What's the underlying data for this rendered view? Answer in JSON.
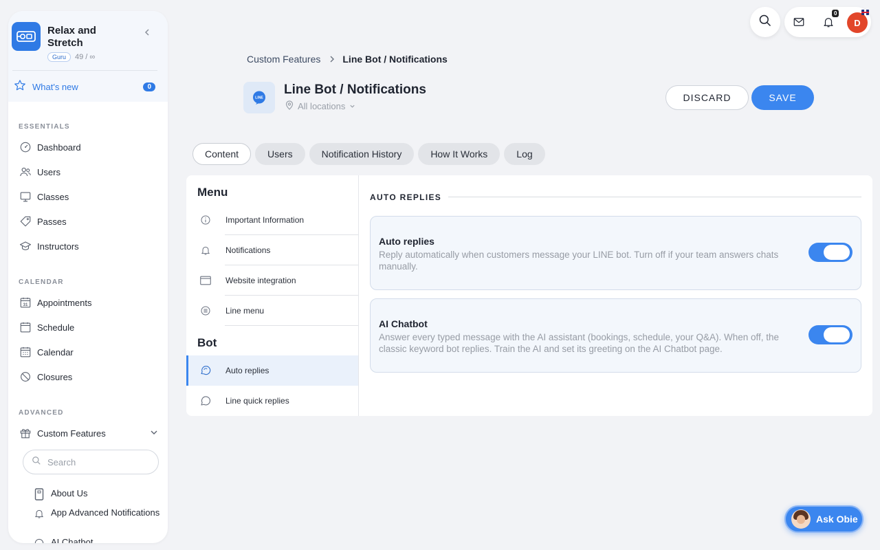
{
  "business": {
    "name": "Relax and Stretch",
    "plan": "Guru",
    "usage": "49 / ∞"
  },
  "whats_new": {
    "label": "What's new",
    "count": "0"
  },
  "sidebar": {
    "sections": [
      {
        "title": "ESSENTIALS",
        "items": [
          "Dashboard",
          "Users",
          "Classes",
          "Passes",
          "Instructors"
        ]
      },
      {
        "title": "CALENDAR",
        "items": [
          "Appointments",
          "Schedule",
          "Calendar",
          "Closures"
        ]
      },
      {
        "title": "ADVANCED",
        "items": [
          "Custom Features"
        ]
      }
    ],
    "calendar_day": "31",
    "search_placeholder": "Search",
    "sub_items": [
      "About Us",
      "App Advanced Notifications",
      "AI Chatbot"
    ]
  },
  "topbar": {
    "notif_count": "0",
    "avatar_initial": "D"
  },
  "breadcrumb": {
    "parent": "Custom Features",
    "current": "Line Bot / Notifications"
  },
  "page": {
    "title": "Line Bot / Notifications",
    "location": "All locations",
    "icon_text": "LINE"
  },
  "actions": {
    "discard": "DISCARD",
    "save": "SAVE"
  },
  "tabs": [
    "Content",
    "Users",
    "Notification History",
    "How It Works",
    "Log"
  ],
  "active_tab": "Content",
  "menu": {
    "heading1": "Menu",
    "items1": [
      "Important Information",
      "Notifications",
      "Website integration",
      "Line menu"
    ],
    "heading2": "Bot",
    "items2": [
      "Auto replies",
      "Line quick replies"
    ],
    "active": "Auto replies"
  },
  "content": {
    "section_title": "AUTO REPLIES",
    "settings": [
      {
        "title": "Auto replies",
        "description": "Reply automatically when customers message your LINE bot. Turn off if your team answers chats manually.",
        "enabled": true
      },
      {
        "title": "AI Chatbot",
        "description": "Answer every typed message with the AI assistant (bookings, schedule, your Q&A). When off, the classic keyword bot replies. Train the AI and set its greeting on the AI Chatbot page.",
        "enabled": true
      }
    ]
  },
  "assistant": {
    "label": "Ask Obie"
  },
  "colors": {
    "accent": "#3b86ef",
    "avatar": "#e2462a"
  }
}
